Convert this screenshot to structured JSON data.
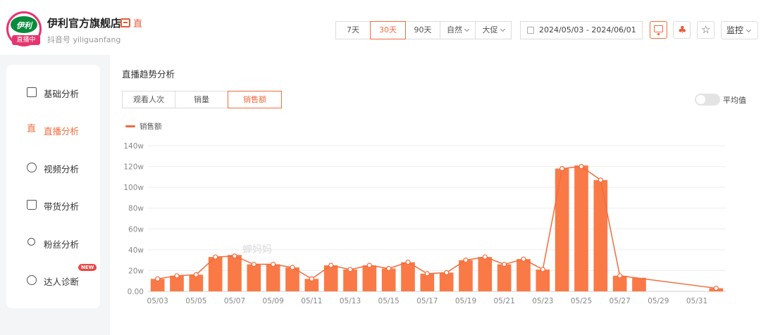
{
  "header": {
    "logo_text": "伊利",
    "live_badge": "直播中",
    "store_name": "伊利官方旗舰店",
    "store_icon": "store-icon",
    "live_icon": "live-icon",
    "live_icon_glyph": "直",
    "douyin_id": "抖音号 yiliguanfang",
    "periods": [
      "7天",
      "30天",
      "90天"
    ],
    "active_period": "30天",
    "filter_natural": "自然",
    "filter_promo": "大促",
    "date_range": "2024/05/03 - 2024/06/01",
    "monitor_label": "监控",
    "star_glyph": "☆",
    "clover_glyph": "♣"
  },
  "sidebar": {
    "items": [
      {
        "label": "基础分析",
        "icon": "bar-chart-icon"
      },
      {
        "label": "直播分析",
        "icon": "live-icon",
        "glyph": "直"
      },
      {
        "label": "视频分析",
        "icon": "play-icon"
      },
      {
        "label": "带货分析",
        "icon": "bag-icon"
      },
      {
        "label": "粉丝分析",
        "icon": "user-icon"
      },
      {
        "label": "达人诊断",
        "icon": "compass-icon",
        "badge": "NEW"
      }
    ],
    "active": "直播分析"
  },
  "main": {
    "title": "直播趋势分析",
    "tabs": [
      "观看人次",
      "销量",
      "销售额"
    ],
    "active_tab": "销售额",
    "toggle_label": "平均值",
    "toggle_on": false,
    "watermark": "蝉妈妈"
  },
  "colors": {
    "accent": "#f26c3d",
    "bar": "#f97a47",
    "grid": "#eeeeee"
  },
  "chart_data": {
    "type": "bar",
    "title": "",
    "series": [
      {
        "name": "销售额"
      }
    ],
    "ylim": [
      0,
      140
    ],
    "y_ticks": [
      "0.00",
      "20w",
      "40w",
      "60w",
      "80w",
      "100w",
      "120w",
      "140w"
    ],
    "x_ticks": [
      "05/03",
      "05/05",
      "05/07",
      "05/09",
      "05/11",
      "05/13",
      "05/15",
      "05/17",
      "05/19",
      "05/21",
      "05/23",
      "05/25",
      "05/27",
      "05/29",
      "05/31"
    ],
    "dates": [
      "05/03",
      "05/04",
      "05/05",
      "05/06",
      "05/07",
      "05/08",
      "05/09",
      "05/10",
      "05/11",
      "05/12",
      "05/13",
      "05/14",
      "05/15",
      "05/16",
      "05/17",
      "05/18",
      "05/19",
      "05/20",
      "05/21",
      "05/22",
      "05/23",
      "05/24",
      "05/25",
      "05/26",
      "05/27",
      "05/28",
      "05/29",
      "05/30",
      "05/31",
      "06/01"
    ],
    "values": [
      12,
      15,
      16,
      33,
      35,
      26,
      26,
      23,
      12,
      25,
      21,
      25,
      22,
      28,
      17,
      18,
      30,
      33,
      26,
      31,
      21,
      118,
      121,
      107,
      15,
      13,
      null,
      null,
      null,
      3
    ],
    "line_values": [
      12,
      15,
      16,
      33,
      34,
      26,
      26,
      23,
      12,
      25,
      21,
      25,
      22,
      28,
      17,
      18,
      30,
      33,
      26,
      31,
      21,
      118,
      120,
      107,
      15,
      null,
      null,
      null,
      null,
      3
    ],
    "grid": true,
    "legend_position": "top-left"
  }
}
